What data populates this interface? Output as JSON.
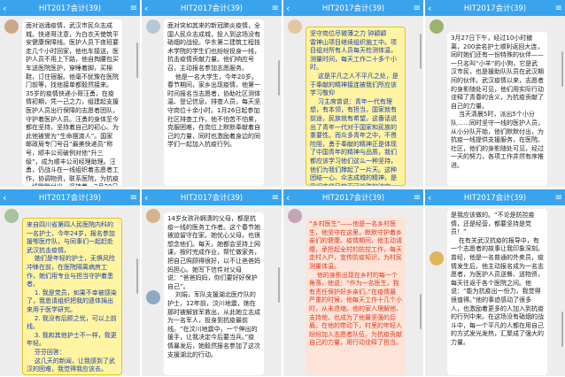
{
  "header": {
    "back_icon": "‹",
    "menu_icon": "≡",
    "title": "HIT2017会计(39)"
  },
  "panels": [
    {
      "name": "",
      "text": "面对汹涌疫情，武汉市民众志成城。快递哥注意，为白衣天使筑平安健康保障线。医护人员下夜班要走几个小时回家，他也车接送，医护人员不用上下路，他自掏腰包买车送医院医护，穿睡着脚，买棉鞋，订住宿服。他毫不犹豫在医院门前等，找他接单都毅然接来。35岁的疫情快递小哥汪勇，在疫情初期，凭一己之力，组建起支援医护人员出行保障的志愿者团队，守护着医护人员。汪勇的身体至今都在坚持，坚持着自己的初心。为此他被誉为“生命摆渡人”。国家邮政局专门号召“最美快递员”称号，顺丰公司破例对他“升三级”，成为顺丰公司经理助理。汪勇，仍战斗在一线组织着志愿者工作，协调物资，联系医院，为抗疫一线默默付出，坚持着。2月28日晚，汪勇等来了关于他的报道，直到现在，他仍在坚持着志愿服务工作。"
    },
    {
      "name": "",
      "text": "面对突如其来的新冠肺炎疫情，全国人民众志成城，投入到这场没有硝烟的战役。华东第二建筑工程技术学院的学生们也纷纷投身一线，抗击疫情贡献力量。他们响应号召，主动报名参加志愿服务。\n    他是一名大学生，今年20岁。春节期间，家乡出现疫情，他第一时间报名当志愿者，协助社区测体温、登记信息，排查人员，每天坚守岗位十余小时。1月26日起参加社区排查工作，他不怕苦不怕累，克服困难，在岗位上默默奉献着自己的力量，同时也激励着身边的同学们一起加入抗疫行列。"
    },
    {
      "name": "",
      "text": "坚守岗位尽微薄之力 钟颖颖\n雷神山项目继续组织施工中。项目组对所有人员每天检测体温，测量时间，每天工作二十多个小时。\n    这是平凡之人不平凡之处，是于奉献的精神接连被我们所应该学习敬仰\n    习主席曾说：青年一代有理想，有本领，有担当，国家就有前途，民族就有希望。这番话说出了青年一代对于国家和民族的重要性。而众多青年之中，不畏险阻，勇于奉献的精神正是体现了中国青年的精神与品质，我们都应该学习他们这么一种坚持，他们为我们撑起了一片天。这种团结一心、众志成城的精神，是我们中华民族不可战胜的法宝，也正是我们这一代青年所应当具备的品格。"
    },
    {
      "name": "",
      "text": "3月27日下午，经过10小时撤离，200余名护士顺利返回大连，同时她们还有一份特殊的伙伴——一只名叫“小羊”的小狗，它是武汉市民，也是援助队队员在武汉期间的伙伴。武汉疫情以来，志愿者的身影随处可见，他们用实际行动诠释了青春的含义，为抗疫贡献了自己的力量。\n    当天清晨5时，派出5个小分队……同时坚守一线的医护人员，从小分队开始，他们默默付出，为抗疫一线提供支援服务，在医院、社区，他们的身影随处可见，经过一天的努力，各项工作井然有序推进。"
    },
    {
      "name": "",
      "text": "来自四川省第四人民医院内科的一名护士，今年24岁，报名参加援鄂医疗队，与同事们一起赶赴武汉抗击疫情。\n    她们是年轻的护士，无惧风险冲锋在前，在医院隔离病房工作，她们用专业与担当守护着患者。\n    1. 我是党员，如果不幸被感染了，我恳请组织把我的遗体捐出来用于医学研究。\n    2. 我没有后顾之忧，可以上前线。\n    3. 我和其他护士不一样，我更年轻。\n    芬芬回答：\n    这几天的新闻，让我感到了武汉的困难，我觉得我应该去。"
    },
    {
      "name": "",
      "text": "14岁女孩孙娴潇的父母，都是抗疫一线的医务工作者。这个春节她被迫留守在家。她忧心父母，也很想念他们。每天，她都会坚持上网课，按时完成作业，帮忙做家务，把自己照顾得很好，以不让爸爸妈妈担心。她写下信件对父母说：“爸爸妈妈，你们要好好保护自己”。\n    刘娟，军队支援湖北医疗队的护士，12年前，汶川地震，她在那时被解放军救出，从此她立志成为一名军人，投身到抗疫最前线。“在汶川地震中，一个伸出的援手，让我决定今后要当兵。”疫情暴发后，她毅然报名参加了这次支援湖北的行动。"
    },
    {
      "name": "",
      "text": "“乡村医生”——他是一名乡村医生，他坚守在这里，默默守护着乡亲们的健康。疫情期间，他主动请缨，承担起全村的防控工作，每天走村入户，宣传防疫知识，为村民测量体温。\n    他的身影出现在乡村的每一个角落，他说：“作为一名医生，我有责任保护好乡亲们。”在疫情最严重的时候，他每天工作十几个小时，从未退缩。他的家人理解他、支持他，也成为了他最坚强的后盾。在他的带动下，村里的年轻人纷纷加入志愿者队伍，为抗疫贡献自己的力量，用行动诠释了担当。"
    },
    {
      "name": "",
      "text": "是我应该做的。“不论是防控疫情，还是经营，都要坚持是党员！”\n    在有关武汉抗疫的报导中，有一个志愿者的故事让我印象深刻。曾经，他是一名普通的外卖员，疫情发生后，他主动报名成为一名志愿者，为医护人员送餐、送物资，每天往返于各个医院之间。他说：“能为抗疫出一份力，我觉得很值得。”他的事迹感动了很多人，也激励着更多的人加入到抗疫的行列中来。在这场没有硝烟的战斗中，每一个平凡的人都在用自己的方式发光发热，汇聚成了强大的力量。"
    }
  ],
  "colors": {
    "header": "#3aa3ee",
    "accent_yellow": "#fff4a1"
  }
}
